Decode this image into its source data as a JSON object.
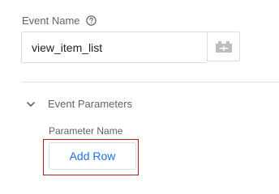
{
  "event_name": {
    "label": "Event Name",
    "help_icon": "help-circle-icon",
    "value": "view_item_list",
    "variable_icon": "variable-picker-icon"
  },
  "event_parameters": {
    "section_title": "Event Parameters",
    "chevron_icon": "chevron-down-icon",
    "column_label": "Parameter Name",
    "add_row_label": "Add Row"
  },
  "colors": {
    "accent": "#1a73e8",
    "highlight_border": "#b71c1c",
    "border": "#dadce0",
    "label": "#5f6368"
  }
}
